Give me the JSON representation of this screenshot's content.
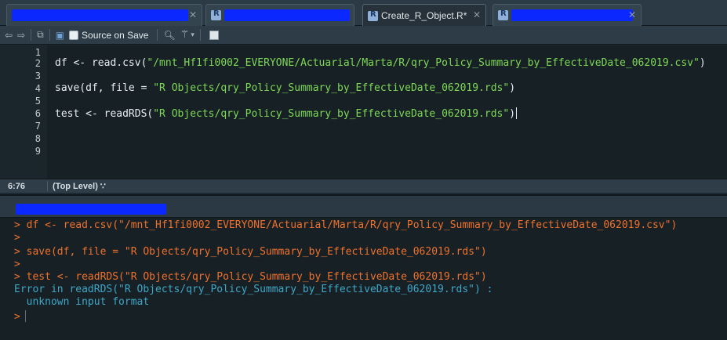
{
  "tabs": [
    {
      "label": "",
      "redacted": true,
      "active": false
    },
    {
      "label": "",
      "redacted": true,
      "active": false
    },
    {
      "label": "Create_R_Object.R*",
      "redacted": false,
      "active": true
    },
    {
      "label": "",
      "redacted": true,
      "active": false
    }
  ],
  "toolbar": {
    "source_on_save_label": "Source on Save"
  },
  "editor": {
    "line_numbers": [
      "1",
      "2",
      "3",
      "4",
      "5",
      "6",
      "7",
      "8",
      "9"
    ],
    "lines": [
      {
        "code": "",
        "string": "",
        "tail": ""
      },
      {
        "code": "df <- read.csv(",
        "string": "\"/mnt_Hf1fi0002_EVERYONE/Actuarial/Marta/R/qry_Policy_Summary_by_EffectiveDate_062019.csv\"",
        "tail": ")"
      },
      {
        "code": "",
        "string": "",
        "tail": ""
      },
      {
        "code": "save(df, file = ",
        "string": "\"R Objects/qry_Policy_Summary_by_EffectiveDate_062019.rds\"",
        "tail": ")"
      },
      {
        "code": "",
        "string": "",
        "tail": ""
      },
      {
        "code": "test <- readRDS(",
        "string": "\"R Objects/qry_Policy_Summary_by_EffectiveDate_062019.rds\"",
        "tail": ")"
      },
      {
        "code": "",
        "string": "",
        "tail": ""
      },
      {
        "code": "",
        "string": "",
        "tail": ""
      },
      {
        "code": "",
        "string": "",
        "tail": ""
      }
    ]
  },
  "status": {
    "position": "6:76",
    "scope": "(Top Level) ∵"
  },
  "console": {
    "lines": [
      {
        "type": "prompt",
        "text": "> df <- read.csv(\"/mnt_Hf1fi0002_EVERYONE/Actuarial/Marta/R/qry_Policy_Summary_by_EffectiveDate_062019.csv\")"
      },
      {
        "type": "prompt",
        "text": ">"
      },
      {
        "type": "prompt",
        "text": "> save(df, file = \"R Objects/qry_Policy_Summary_by_EffectiveDate_062019.rds\")"
      },
      {
        "type": "prompt",
        "text": ">"
      },
      {
        "type": "prompt",
        "text": "> test <- readRDS(\"R Objects/qry_Policy_Summary_by_EffectiveDate_062019.rds\")"
      },
      {
        "type": "error",
        "text": "Error in readRDS(\"R Objects/qry_Policy_Summary_by_EffectiveDate_062019.rds\") :"
      },
      {
        "type": "error",
        "text": "  unknown input format"
      },
      {
        "type": "prompt",
        "text": ">"
      }
    ]
  },
  "colors": {
    "redaction": "#0a28ff",
    "string": "#7fd957",
    "prompt": "#f0712b",
    "error": "#3fa7c7"
  },
  "icons": [
    "back-arrow-icon",
    "forward-arrow-icon",
    "show-in-window-icon",
    "save-icon",
    "search-icon",
    "code-tools-wand-icon",
    "chevron-down-icon",
    "compile-report-icon",
    "r-file-icon",
    "close-icon"
  ]
}
